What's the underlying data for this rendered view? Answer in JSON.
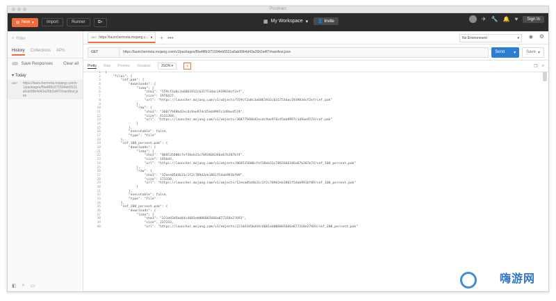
{
  "window": {
    "title": "Postman"
  },
  "toolbar": {
    "new_label": "New",
    "import_label": "Import",
    "runner_label": "Runner",
    "workspace_label": "My Workspace",
    "invite_label": "Invite",
    "signin_label": "Sign In"
  },
  "sidebar": {
    "filter_placeholder": "Filter",
    "tabs": [
      "History",
      "Collections",
      "APIs"
    ],
    "save_responses": "Save Responses",
    "clear_all": "Clear all",
    "group_label": "Today",
    "history": [
      {
        "method": "GET",
        "url": "https://launchermeta.mojang.com/v1/packages/f9a48fb1f71594eb5531a6ab99b4d43a26b2a4f7/manifest.json"
      }
    ]
  },
  "main": {
    "tab": {
      "method": "GET",
      "label": "https://launchermeta.mojang.c..."
    },
    "environment": "No Environment",
    "request": {
      "method": "GET",
      "url": "https://launchermeta.mojang.com/v1/packages/f9a48fb1f71594eb5531a6ab99b4d43a26b2a4f7/manifest.json",
      "send_label": "Send",
      "save_label": "Save"
    },
    "response_tabs": [
      "Pretty",
      "Raw",
      "Preview",
      "Visualize"
    ],
    "format": "JSON",
    "lines": [
      {
        "n": 1,
        "t": "{"
      },
      {
        "n": 2,
        "t": "    \"files\": {"
      },
      {
        "n": 3,
        "t": "        \"cef.pak\": {"
      },
      {
        "n": 4,
        "t": "            \"downloads\": {"
      },
      {
        "n": 5,
        "t": "                \"lzma\": {"
      },
      {
        "n": 6,
        "t": "                    \"sha1\": \"559cf2a8c3a6861932c631753dac193983dcf2ef\","
      },
      {
        "n": 7,
        "t": "                    \"size\": 1976427,"
      },
      {
        "n": 8,
        "t": "                    \"url\": \"https://launcher.mojang.com/v1/objects/559cf2a8c3a6861932c631753dac193983dcf2ef/cef.pak\""
      },
      {
        "n": 9,
        "t": "                },"
      },
      {
        "n": 10,
        "t": "                \"raw\": {"
      },
      {
        "n": 11,
        "t": "                    \"sha1\": \"36877948bd2ecdc9ae97dc45eb9997c1d9ae4574\","
      },
      {
        "n": 12,
        "t": "                    \"size\": 4131368,"
      },
      {
        "n": 13,
        "t": "                    \"url\": \"https://launcher.mojang.com/v1/objects/36877948bd2ecdc9ae97dc45eb9997c1d9ae4574/cef.pak\""
      },
      {
        "n": 14,
        "t": "                }"
      },
      {
        "n": 15,
        "t": "            },"
      },
      {
        "n": 16,
        "t": "            \"executable\": false,"
      },
      {
        "n": 17,
        "t": "            \"type\": \"file\""
      },
      {
        "n": 18,
        "t": "        },"
      },
      {
        "n": 19,
        "t": "        \"cef_100_percent.pak\": {"
      },
      {
        "n": 20,
        "t": "            \"downloads\": {"
      },
      {
        "n": 21,
        "t": "                \"lzma\": {"
      },
      {
        "n": 22,
        "t": "                    \"sha1\": \"060535600cfef36eb31c7892666346a67b307b74\","
      },
      {
        "n": 23,
        "t": "                    \"size\": 145644,"
      },
      {
        "n": 24,
        "t": "                    \"url\": \"https://launcher.mojang.com/v1/objects/060535600cfef36eb31c7892666346a67b307b74/cef_100_percent.pak\""
      },
      {
        "n": 25,
        "t": "                },"
      },
      {
        "n": 26,
        "t": "                \"raw\": {"
      },
      {
        "n": 27,
        "t": "                    \"sha1\": \"12eea05d4b31c1f2c709d2eb1861f5dab991bf09\","
      },
      {
        "n": 28,
        "t": "                    \"size\": 173338,"
      },
      {
        "n": 29,
        "t": "                    \"url\": \"https://launcher.mojang.com/v1/objects/12eea05d4b31c1f2c709d2eb1861f5dab991bf09/cef_100_percent.pak\""
      },
      {
        "n": 30,
        "t": "                }"
      },
      {
        "n": 31,
        "t": "            },"
      },
      {
        "n": 32,
        "t": "            \"executable\": false,"
      },
      {
        "n": 33,
        "t": "            \"type\": \"file\""
      },
      {
        "n": 34,
        "t": "        },"
      },
      {
        "n": 35,
        "t": "        \"cef_200_percent.pak\": {"
      },
      {
        "n": 36,
        "t": "            \"downloads\": {"
      },
      {
        "n": 37,
        "t": "                \"lzma\": {"
      },
      {
        "n": 38,
        "t": "                    \"sha1\": \"221dd3d5bd44c4601eb006065666a877318e27693\","
      },
      {
        "n": 39,
        "t": "                    \"size\": 237233,"
      },
      {
        "n": 40,
        "t": "                    \"url\": \"https://launcher.mojang.com/v1/objects/221dd3d5bd44c4601eb006065666a877318e27693/cef_200_percent.pak\""
      }
    ]
  },
  "watermark": {
    "text": "嗨游网"
  }
}
